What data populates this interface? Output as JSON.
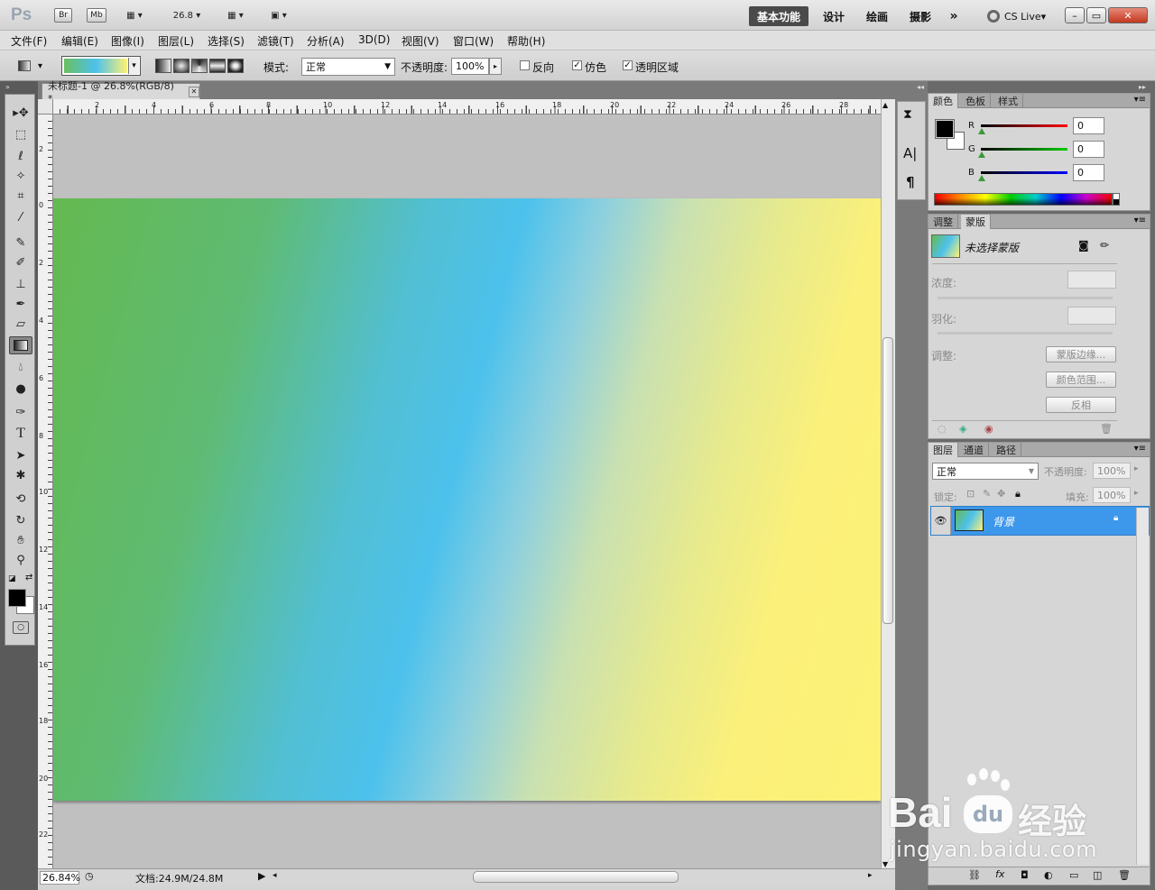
{
  "app": {
    "logo": "Ps",
    "br": "Br",
    "mb": "Mb",
    "zoom": "26.8"
  },
  "workspaces": [
    "基本功能",
    "设计",
    "绘画",
    "摄影",
    "»"
  ],
  "cslive": "CS Live",
  "window_buttons": [
    "–",
    "▭",
    "✕"
  ],
  "menu": [
    "文件(F)",
    "编辑(E)",
    "图像(I)",
    "图层(L)",
    "选择(S)",
    "滤镜(T)",
    "分析(A)",
    "3D(D)",
    "视图(V)",
    "窗口(W)",
    "帮助(H)"
  ],
  "options": {
    "mode_label": "模式:",
    "mode_value": "正常",
    "opacity_label": "不透明度:",
    "opacity_value": "100%",
    "reverse_label": "反向",
    "reverse_checked": false,
    "dither_label": "仿色",
    "dither_checked": true,
    "transparency_label": "透明区域",
    "transparency_checked": true
  },
  "document": {
    "tab_title": "未标题-1 @ 26.8%(RGB/8) *",
    "close": "✕",
    "zoom_status": "26.84%",
    "doc_size": "文档:24.9M/24.8M"
  },
  "hruler": [
    "2",
    "4",
    "6",
    "8",
    "10",
    "12",
    "14",
    "16",
    "18",
    "20",
    "22",
    "24",
    "26",
    "28"
  ],
  "vruler": [
    "2",
    "0",
    "2",
    "4",
    "6",
    "8",
    "10",
    "12",
    "14",
    "16",
    "18",
    "20",
    "22"
  ],
  "color_panel": {
    "tabs": [
      "颜色",
      "色板",
      "样式"
    ],
    "r_label": "R",
    "g_label": "G",
    "b_label": "B",
    "r": "0",
    "g": "0",
    "b": "0"
  },
  "mask_panel": {
    "tabs": [
      "调整",
      "蒙版"
    ],
    "title": "未选择蒙版",
    "density_label": "浓度:",
    "feather_label": "羽化:",
    "refine_label": "调整:",
    "btn_edge": "蒙版边缘...",
    "btn_range": "颜色范围...",
    "btn_invert": "反相"
  },
  "layers_panel": {
    "tabs": [
      "图层",
      "通道",
      "路径"
    ],
    "blend": "正常",
    "opacity_label": "不透明度:",
    "opacity": "100%",
    "lock_label": "锁定:",
    "fill_label": "填充:",
    "fill": "100%",
    "layer_name": "背景"
  },
  "watermark": {
    "brand_left": "Bai",
    "brand_mid": "du",
    "brand_right": "经验",
    "url": "jingyan.baidu.com"
  }
}
